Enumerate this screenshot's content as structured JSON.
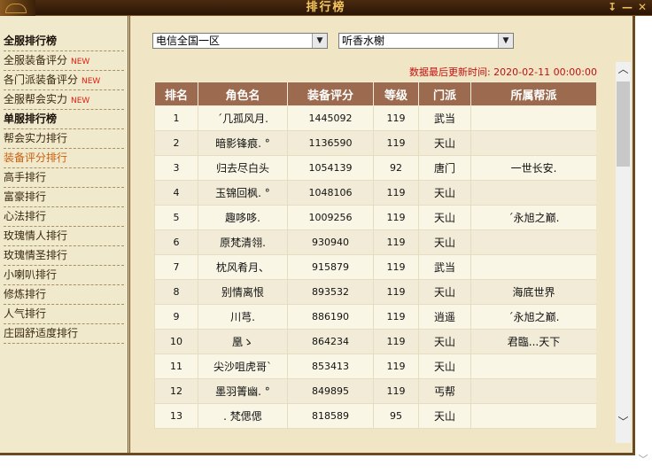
{
  "window": {
    "title": "排行榜",
    "controls": [
      "↧",
      "—",
      "✕"
    ]
  },
  "sidebar": {
    "items": [
      {
        "label": "全服排行榜",
        "header": true,
        "new": ""
      },
      {
        "label": "全服装备评分",
        "header": false,
        "new": "NEW"
      },
      {
        "label": "各门派装备评分",
        "header": false,
        "new": "NEW"
      },
      {
        "label": "全服帮会实力",
        "header": false,
        "new": "NEW"
      },
      {
        "label": "单服排行榜",
        "header": true,
        "new": ""
      },
      {
        "label": "帮会实力排行",
        "header": false,
        "new": ""
      },
      {
        "label": "装备评分排行",
        "header": false,
        "new": "",
        "active": true
      },
      {
        "label": "高手排行",
        "header": false,
        "new": ""
      },
      {
        "label": "富豪排行",
        "header": false,
        "new": ""
      },
      {
        "label": "心法排行",
        "header": false,
        "new": ""
      },
      {
        "label": "玫瑰情人排行",
        "header": false,
        "new": ""
      },
      {
        "label": "玫瑰情圣排行",
        "header": false,
        "new": ""
      },
      {
        "label": "小喇叭排行",
        "header": false,
        "new": ""
      },
      {
        "label": "修炼排行",
        "header": false,
        "new": ""
      },
      {
        "label": "人气排行",
        "header": false,
        "new": ""
      },
      {
        "label": "庄园舒适度排行",
        "header": false,
        "new": ""
      }
    ]
  },
  "filters": {
    "region": "电信全国一区",
    "server": "听香水榭"
  },
  "update_time": "数据最后更新时间: 2020-02-11 00:00:00",
  "table": {
    "columns": [
      "排名",
      "角色名",
      "装备评分",
      "等级",
      "门派",
      "所属帮派"
    ],
    "rows": [
      [
        "1",
        "ˊ几孤风月.",
        "1445092",
        "119",
        "武当",
        ""
      ],
      [
        "2",
        "暗影锋痕. °",
        "1136590",
        "119",
        "天山",
        ""
      ],
      [
        "3",
        "归去尽白头",
        "1054139",
        "92",
        "唐门",
        "一世长安."
      ],
      [
        "4",
        "玉锦回枫. °",
        "1048106",
        "119",
        "天山",
        ""
      ],
      [
        "5",
        "趣哆哆.",
        "1009256",
        "119",
        "天山",
        "ˊ永旭之巅."
      ],
      [
        "6",
        "原梵清翎.",
        "930940",
        "119",
        "天山",
        ""
      ],
      [
        "7",
        "枕风肴月、",
        "915879",
        "119",
        "武当",
        ""
      ],
      [
        "8",
        "别情离恨",
        "893532",
        "119",
        "天山",
        "海底世界"
      ],
      [
        "9",
        "川芎.",
        "886190",
        "119",
        "逍遥",
        "ˊ永旭之巅."
      ],
      [
        "10",
        "凰ゝ",
        "864234",
        "119",
        "天山",
        "君臨...天下"
      ],
      [
        "11",
        "尖沙咀虎哥ˋ",
        "853413",
        "119",
        "天山",
        ""
      ],
      [
        "12",
        "墨羽箐幽. °",
        "849895",
        "119",
        "丐帮",
        ""
      ],
      [
        "13",
        ". 梵偲偲",
        "818589",
        "95",
        "天山",
        ""
      ]
    ]
  },
  "icons": {
    "scroll_up": "chevron-up-icon",
    "scroll_down": "chevron-down-icon",
    "dropdown": "dropdown-arrow-icon"
  },
  "colors": {
    "header_bg": "#9c6a4e",
    "title_text": "#f6c860",
    "update_text": "#c01010",
    "new_badge": "#e02010",
    "active_item": "#c86010"
  }
}
